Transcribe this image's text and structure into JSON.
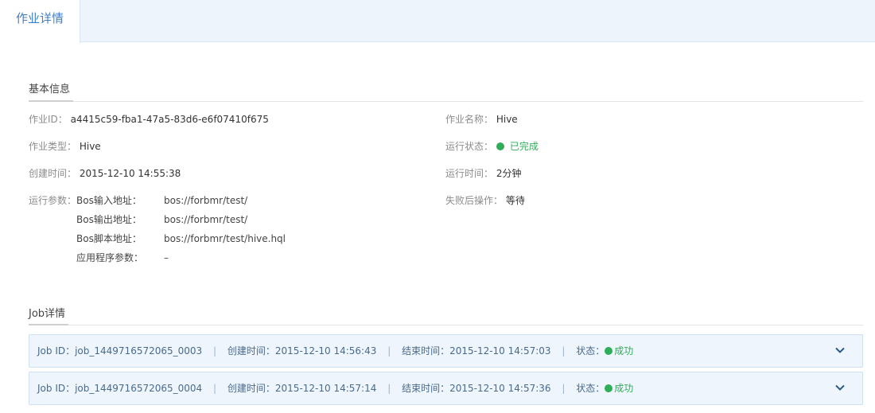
{
  "tabs": {
    "active_label": "作业详情"
  },
  "basic": {
    "title": "基本信息",
    "job_id_label": "作业ID：",
    "job_id_value": "a4415c59-fba1-47a5-83d6-e6f07410f675",
    "job_name_label": "作业名称：",
    "job_name_value": "Hive",
    "job_type_label": "作业类型：",
    "job_type_value": "Hive",
    "run_status_label": "运行状态：",
    "run_status_value": "已完成",
    "created_label": "创建时间：",
    "created_value": "2015-12-10 14:55:38",
    "run_time_label": "运行时间：",
    "run_time_value": "2分钟",
    "params_label": "运行参数：",
    "params": [
      {
        "key": "Bos输入地址：",
        "value": "bos://forbmr/test/"
      },
      {
        "key": "Bos输出地址：",
        "value": "bos://forbmr/test/"
      },
      {
        "key": "Bos脚本地址：",
        "value": "bos://forbmr/test/hive.hql"
      },
      {
        "key": "应用程序参数：",
        "value": "–"
      }
    ],
    "fail_action_label": "失败后操作：",
    "fail_action_value": "等待"
  },
  "jobs_section": {
    "title": "Job详情",
    "rows": [
      {
        "id_label": "Job ID：",
        "id": "job_1449716572065_0003",
        "start_label": "创建时间：",
        "start": "2015-12-10 14:56:43",
        "end_label": "结束时间：",
        "end": "2015-12-10 14:57:03",
        "status_label": "状态：",
        "status": "成功"
      },
      {
        "id_label": "Job ID：",
        "id": "job_1449716572065_0004",
        "start_label": "创建时间：",
        "start": "2015-12-10 14:57:14",
        "end_label": "结束时间：",
        "end": "2015-12-10 14:57:36",
        "status_label": "状态：",
        "status": "成功"
      }
    ]
  },
  "colors": {
    "accent": "#3f7fc7",
    "success": "#2fae5a",
    "tab_bg": "#eef4fc"
  }
}
